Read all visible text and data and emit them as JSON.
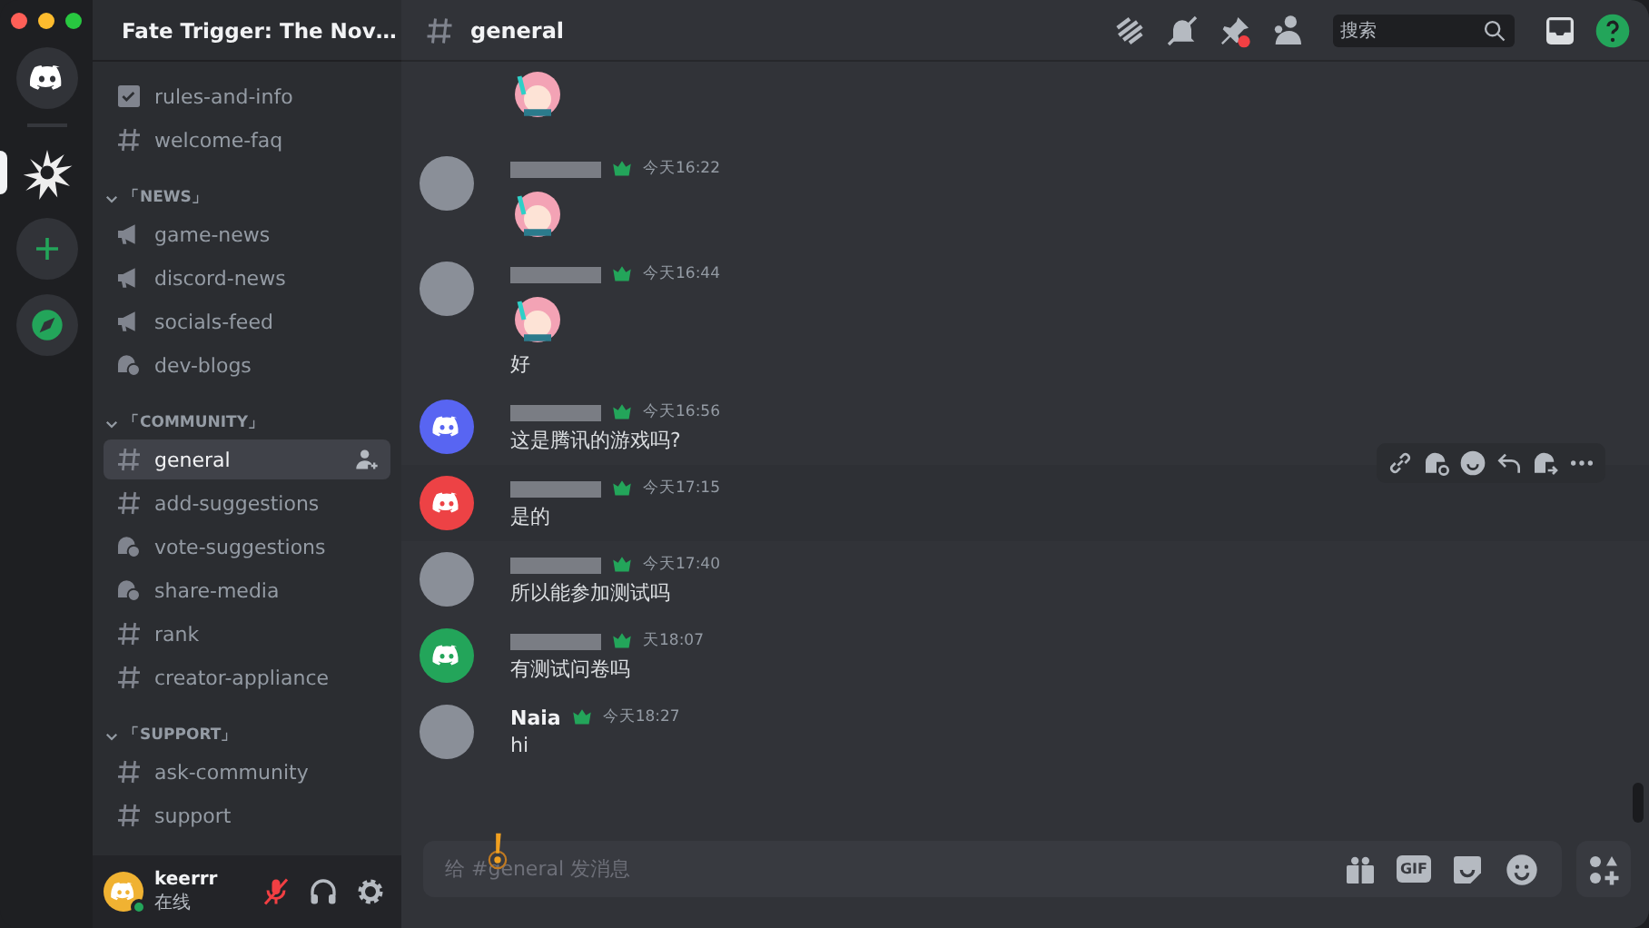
{
  "servers": [
    {
      "kind": "home",
      "selected": false
    },
    {
      "kind": "server",
      "selected": true
    },
    {
      "kind": "add",
      "selected": false
    },
    {
      "kind": "explore",
      "selected": false
    }
  ],
  "server_header": {
    "name": "Fate Trigger: The Nov…"
  },
  "top_channels": [
    {
      "name": "rules-and-info",
      "kind": "rules",
      "selected": false
    },
    {
      "name": "welcome-faq",
      "kind": "text",
      "selected": false
    }
  ],
  "categories": [
    {
      "name": "「NEWS」",
      "expanded": true,
      "channels": [
        {
          "name": "game-news",
          "kind": "announcement",
          "selected": false
        },
        {
          "name": "discord-news",
          "kind": "announcement",
          "selected": false
        },
        {
          "name": "socials-feed",
          "kind": "announcement",
          "selected": false
        },
        {
          "name": "dev-blogs",
          "kind": "forum",
          "selected": false
        }
      ]
    },
    {
      "name": "「COMMUNITY」",
      "expanded": true,
      "channels": [
        {
          "name": "general",
          "kind": "text",
          "selected": true
        },
        {
          "name": "add-suggestions",
          "kind": "text",
          "selected": false
        },
        {
          "name": "vote-suggestions",
          "kind": "forum",
          "selected": false
        },
        {
          "name": "share-media",
          "kind": "forum",
          "selected": false
        },
        {
          "name": "rank",
          "kind": "text",
          "selected": false
        },
        {
          "name": "creator-appliance",
          "kind": "text",
          "selected": false
        }
      ]
    },
    {
      "name": "「SUPPORT」",
      "expanded": true,
      "channels": [
        {
          "name": "ask-community",
          "kind": "text",
          "selected": false
        },
        {
          "name": "support",
          "kind": "text",
          "selected": false
        }
      ]
    }
  ],
  "user_panel": {
    "name": "keerrr",
    "status": "在线",
    "mic_muted": true
  },
  "chat": {
    "channel": "general",
    "search_placeholder": "搜索",
    "messages": [
      {
        "continuation": true,
        "highlighted": false,
        "body": [
          {
            "kind": "sticker"
          }
        ]
      },
      {
        "continuation": false,
        "highlighted": false,
        "avatar": {
          "kind": "photo"
        },
        "time": "今天16:22",
        "body": [
          {
            "kind": "sticker"
          }
        ]
      },
      {
        "continuation": false,
        "highlighted": false,
        "avatar": {
          "kind": "photo"
        },
        "time": "今天16:44",
        "body": [
          {
            "kind": "sticker"
          },
          {
            "kind": "text",
            "text": "好"
          }
        ]
      },
      {
        "continuation": false,
        "highlighted": false,
        "avatar": {
          "kind": "discord",
          "color": "#5865f2"
        },
        "time": "今天16:56",
        "body": [
          {
            "kind": "text",
            "text": "这是腾讯的游戏吗?"
          }
        ]
      },
      {
        "continuation": false,
        "highlighted": true,
        "avatar": {
          "kind": "discord",
          "color": "#ed4245"
        },
        "time": "今天17:15",
        "body": [
          {
            "kind": "text",
            "text": "是的"
          }
        ]
      },
      {
        "continuation": false,
        "highlighted": false,
        "avatar": {
          "kind": "photo"
        },
        "time": "今天17:40",
        "body": [
          {
            "kind": "text",
            "text": "所以能参加测试吗"
          }
        ]
      },
      {
        "continuation": false,
        "highlighted": false,
        "avatar": {
          "kind": "discord",
          "color": "#23a55a"
        },
        "time": "天18:07",
        "body": [
          {
            "kind": "text",
            "text": "有测试问卷吗"
          }
        ]
      },
      {
        "continuation": false,
        "highlighted": false,
        "author": "Naia",
        "avatar": {
          "kind": "photo"
        },
        "time": "今天18:27",
        "body": [
          {
            "kind": "text",
            "text": "hi"
          }
        ]
      }
    ],
    "input": {
      "placeholder": "给 #general 发消息"
    },
    "input_buttons": [
      {
        "kind": "gift"
      },
      {
        "kind": "gif",
        "label": "GIF"
      },
      {
        "kind": "sticker"
      },
      {
        "kind": "emoji"
      }
    ]
  }
}
